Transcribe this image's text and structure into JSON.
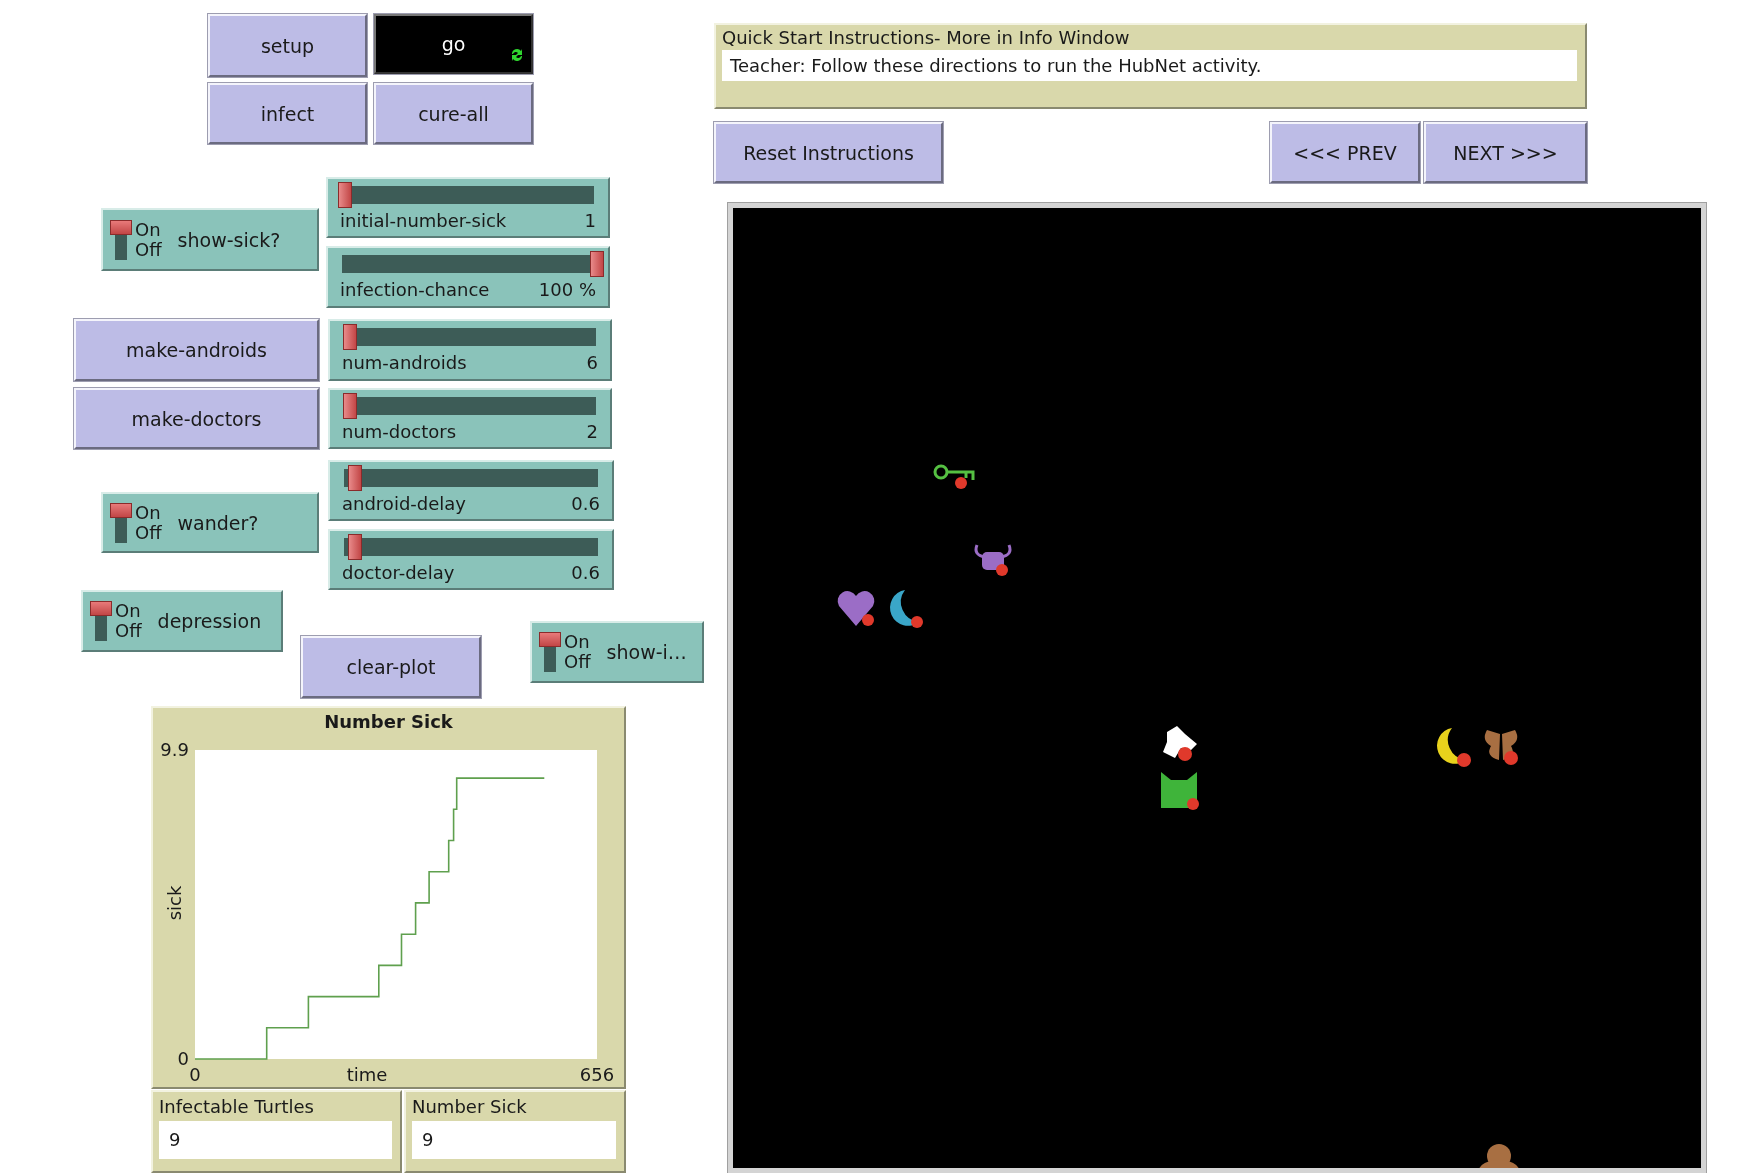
{
  "widgets": [
    {
      "kind": "button",
      "label": "setup"
    },
    {
      "kind": "forever_button",
      "label": "go"
    },
    {
      "kind": "button",
      "label": "infect"
    },
    {
      "kind": "button",
      "label": "cure-all"
    },
    {
      "kind": "switch",
      "on_text": "On",
      "off_text": "Off",
      "label": "show-sick?",
      "on": true
    },
    {
      "kind": "slider",
      "label": "initial-number-sick",
      "reading": "1",
      "level": 0
    },
    {
      "kind": "slider",
      "label": "infection-chance",
      "reading": "100 %",
      "level": 1
    },
    {
      "kind": "button",
      "label": "make-androids"
    },
    {
      "kind": "slider",
      "label": "num-androids",
      "reading": "6",
      "level": 0.01
    },
    {
      "kind": "button",
      "label": "make-doctors"
    },
    {
      "kind": "slider",
      "label": "num-doctors",
      "reading": "2",
      "level": 0.01
    },
    {
      "kind": "switch",
      "on_text": "On",
      "off_text": "Off",
      "label": "wander?",
      "on": true
    },
    {
      "kind": "slider",
      "label": "android-delay",
      "reading": "0.6",
      "level": 0.03
    },
    {
      "kind": "slider",
      "label": "doctor-delay",
      "reading": "0.6",
      "level": 0.03
    },
    {
      "kind": "switch",
      "on_text": "On",
      "off_text": "Off",
      "label": "depression",
      "on": true
    },
    {
      "kind": "button",
      "label": "clear-plot"
    },
    {
      "kind": "switch",
      "on_text": "On",
      "off_text": "Off",
      "label": "show-i…",
      "on": true
    },
    {
      "kind": "plot",
      "chart_data": {
        "type": "line",
        "title": "Number Sick",
        "xlabel": "time",
        "ylabel": "sick",
        "x": [
          0,
          117,
          117,
          185,
          185,
          300,
          300,
          337,
          337,
          360,
          360,
          382,
          382,
          414,
          414,
          422,
          422,
          427,
          427,
          570
        ],
        "series": [
          {
            "color": "#5fa04e",
            "values": [
              0,
              0,
              1,
              1,
              2,
              2,
              3,
              3,
              4,
              4,
              5,
              5,
              6,
              6,
              7,
              7,
              8,
              8,
              9,
              9
            ]
          }
        ],
        "xlim": [
          0,
          656
        ],
        "ylim": [
          0,
          9.9
        ],
        "xticks": [
          0,
          656
        ],
        "yticks": [
          0,
          9.9
        ]
      }
    },
    {
      "kind": "monitor",
      "label": "Infectable Turtles",
      "value": "9"
    },
    {
      "kind": "monitor",
      "label": "Number Sick",
      "value": "9"
    },
    {
      "kind": "note",
      "title": "Quick Start Instructions- More in Info Window",
      "text": "Teacher: Follow these directions to run the HubNet activity."
    },
    {
      "kind": "button",
      "label": "Reset Instructions"
    },
    {
      "kind": "button",
      "label": "<<< PREV"
    },
    {
      "kind": "button",
      "label": "NEXT >>>"
    },
    {
      "kind": "view"
    }
  ]
}
